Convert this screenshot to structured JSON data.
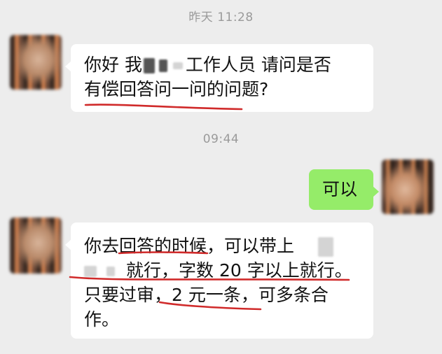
{
  "chat": {
    "timestamp_1": "昨天 11:28",
    "timestamp_2": "09:44",
    "msg1": {
      "line1_pre": "你好 我",
      "line1_post": "工作人员 请问是否",
      "line2": "有偿回答问一问的问题?"
    },
    "msg2": {
      "text": "可以"
    },
    "msg3": {
      "line1": "你去回答的时候，可以带上",
      "line2": "就行，字数 20 字以上就行。",
      "line3": "只要过审，2 元一条，可多条合",
      "line4": "作。"
    }
  },
  "colors": {
    "background": "#ededed",
    "incoming_bubble": "#ffffff",
    "outgoing_bubble": "#95ec69",
    "annotation_red": "#d02a2a",
    "timestamp_text": "#9a9a9a"
  }
}
